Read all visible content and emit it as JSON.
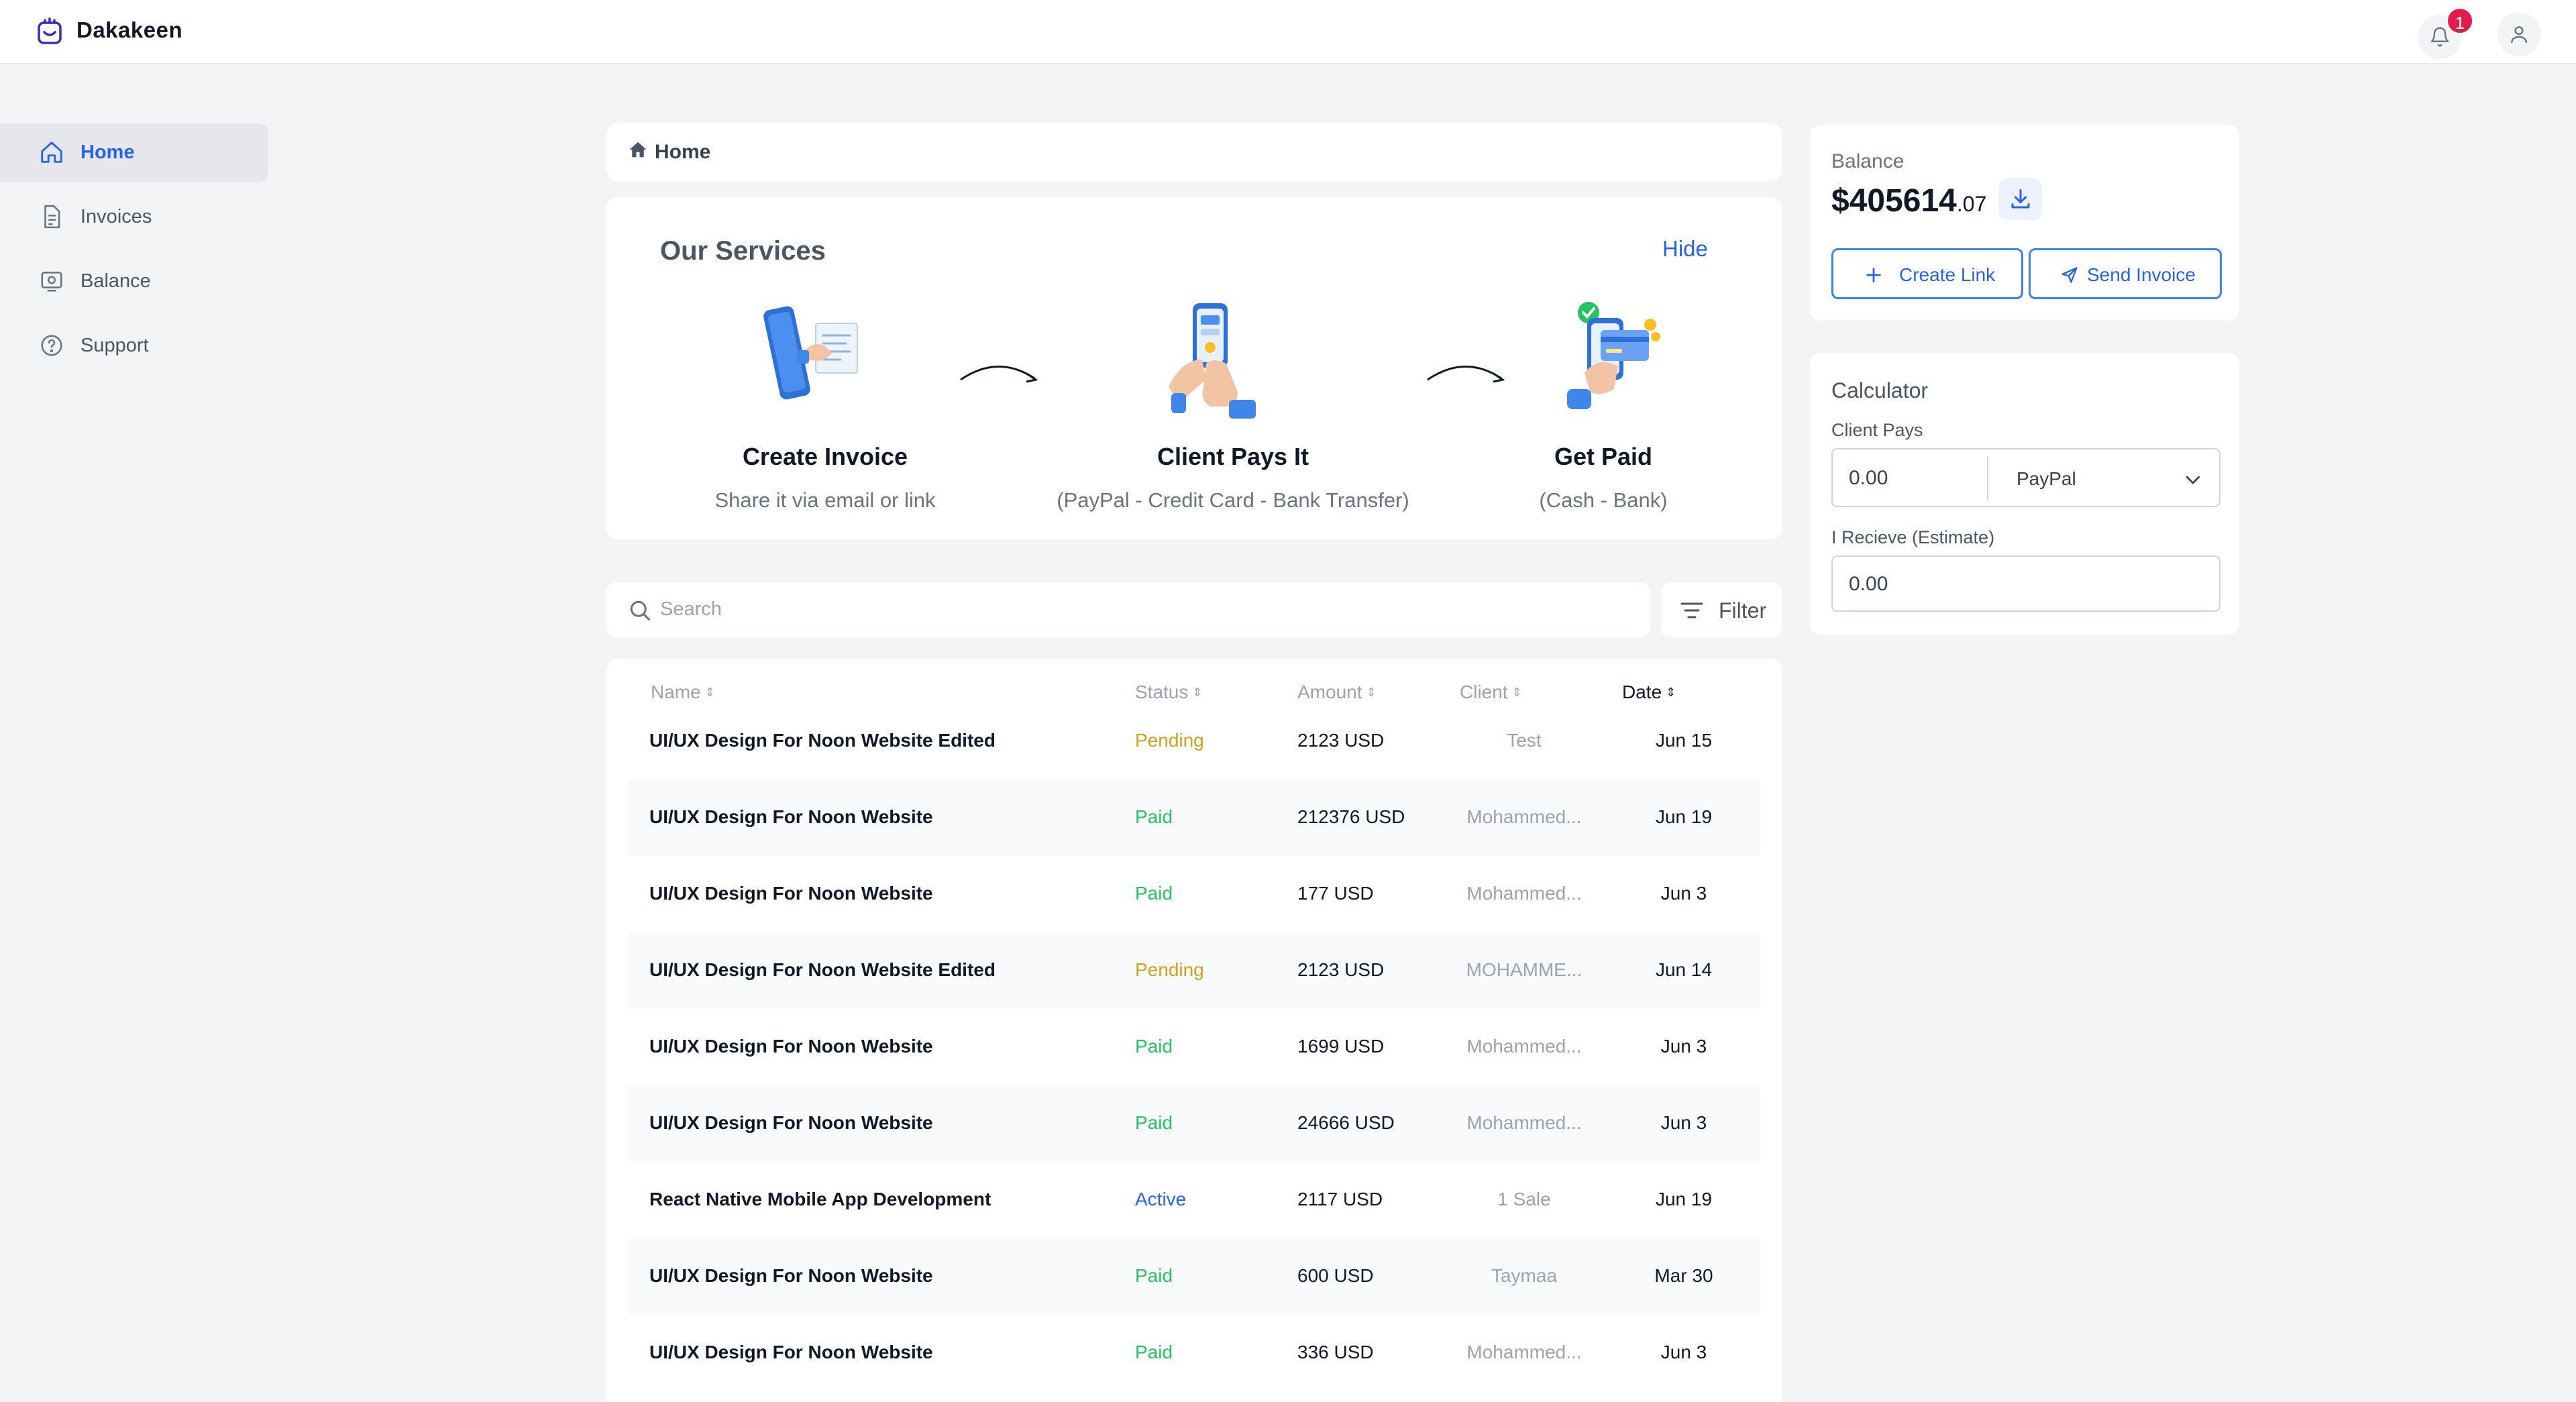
{
  "app": {
    "name": "Dakakeen",
    "notification_count": "1"
  },
  "sidebar": {
    "items": [
      {
        "label": "Home",
        "icon": "home-icon",
        "active": true
      },
      {
        "label": "Invoices",
        "icon": "document-icon",
        "active": false
      },
      {
        "label": "Balance",
        "icon": "wallet-icon",
        "active": false
      },
      {
        "label": "Support",
        "icon": "help-icon",
        "active": false
      }
    ]
  },
  "breadcrumb": {
    "label": "Home"
  },
  "services": {
    "title": "Our Services",
    "hide_label": "Hide",
    "steps": [
      {
        "title": "Create Invoice",
        "subtitle": "Share it via email or link",
        "icon": "phone-invoice-illustration"
      },
      {
        "title": "Client Pays It",
        "subtitle": "(PayPal - Credit Card - Bank Transfer)",
        "icon": "phone-payment-illustration"
      },
      {
        "title": "Get Paid",
        "subtitle": "(Cash - Bank)",
        "icon": "phone-card-paid-illustration"
      }
    ]
  },
  "search": {
    "placeholder": "Search"
  },
  "filter": {
    "label": "Filter"
  },
  "table": {
    "columns": [
      "Name",
      "Status",
      "Amount",
      "Client",
      "Date"
    ],
    "rows": [
      {
        "name": "UI/UX Design For Noon Website Edited",
        "status": "Pending",
        "amount": "2123 USD",
        "client": "Test",
        "date": "Jun 15"
      },
      {
        "name": "UI/UX Design For Noon Website",
        "status": "Paid",
        "amount": "212376 USD",
        "client": "Mohammed...",
        "date": "Jun 19"
      },
      {
        "name": "UI/UX Design For Noon Website",
        "status": "Paid",
        "amount": "177 USD",
        "client": "Mohammed...",
        "date": "Jun 3"
      },
      {
        "name": "UI/UX Design For Noon Website Edited",
        "status": "Pending",
        "amount": "2123 USD",
        "client": "MOHAMME...",
        "date": "Jun 14"
      },
      {
        "name": "UI/UX Design For Noon Website",
        "status": "Paid",
        "amount": "1699 USD",
        "client": "Mohammed...",
        "date": "Jun 3"
      },
      {
        "name": "UI/UX Design For Noon Website",
        "status": "Paid",
        "amount": "24666 USD",
        "client": "Mohammed...",
        "date": "Jun 3"
      },
      {
        "name": "React Native Mobile App Development",
        "status": "Active",
        "amount": "2117 USD",
        "client": "1 Sale",
        "date": "Jun 19"
      },
      {
        "name": "UI/UX Design For Noon Website",
        "status": "Paid",
        "amount": "600 USD",
        "client": "Taymaa",
        "date": "Mar 30"
      },
      {
        "name": "UI/UX Design For Noon Website",
        "status": "Paid",
        "amount": "336 USD",
        "client": "Mohammed...",
        "date": "Jun 3"
      }
    ]
  },
  "status_colors": {
    "Pending": "#d4a017",
    "Paid": "#22c55e",
    "Active": "#2563eb"
  },
  "balance": {
    "label": "Balance",
    "amount_main": "$405614",
    "amount_cents": ".07",
    "create_link_label": "Create Link",
    "send_invoice_label": "Send Invoice"
  },
  "calculator": {
    "title": "Calculator",
    "client_pays_label": "Client Pays",
    "client_pays_value": "0.00",
    "method_value": "PayPal",
    "receive_label": "I Recieve (Estimate)",
    "receive_value": "0.00"
  },
  "colors": {
    "accent": "#2563eb",
    "background": "#f3f4f6"
  }
}
